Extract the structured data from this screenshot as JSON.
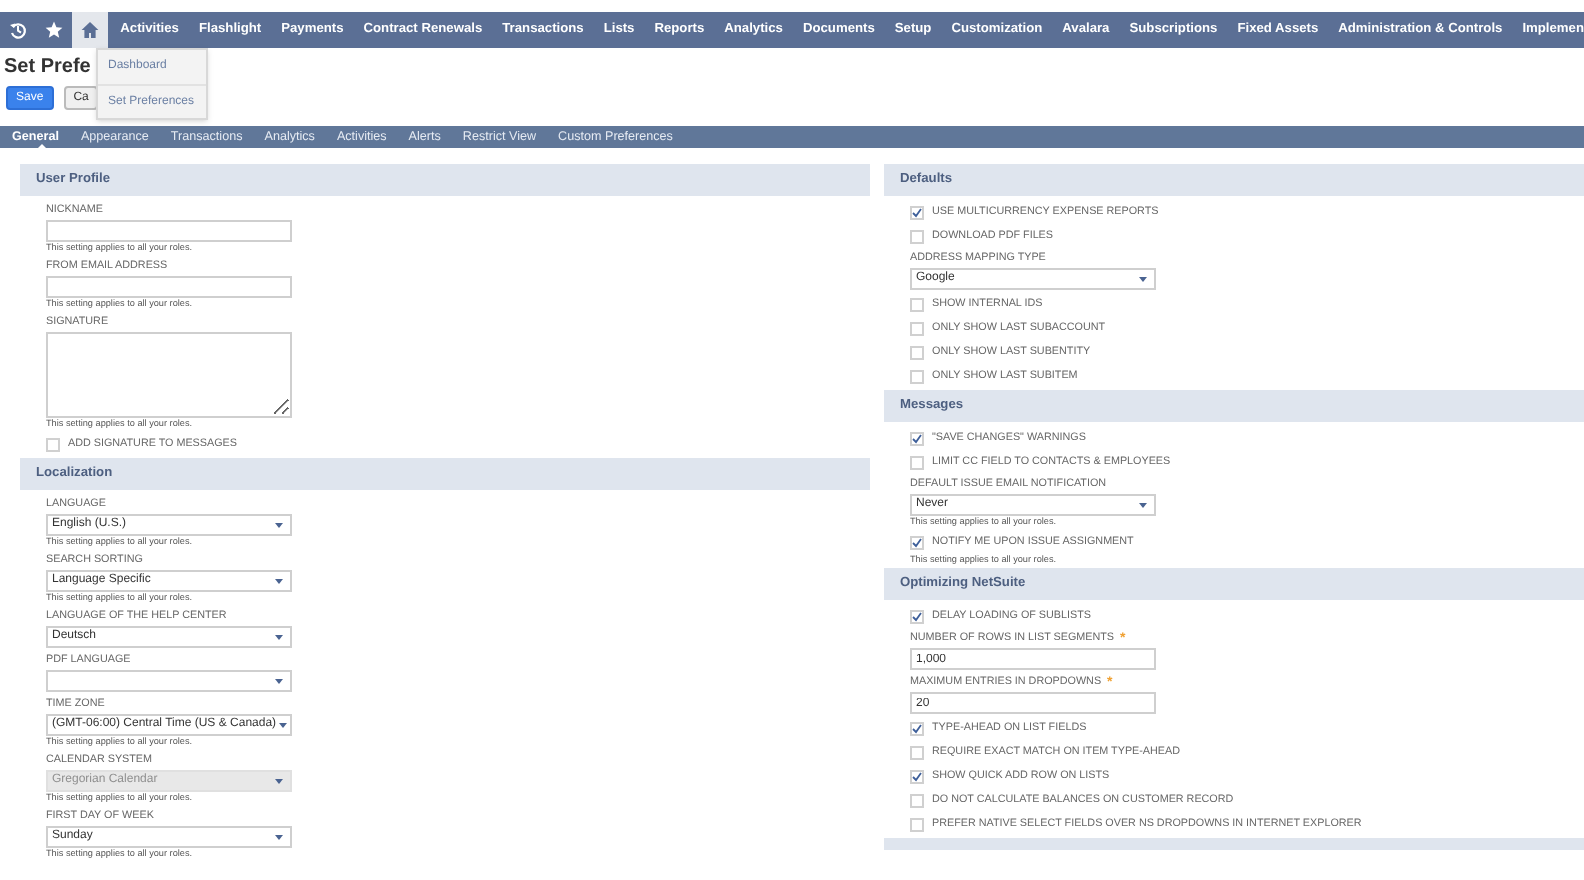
{
  "nav": {
    "icon_buttons": [
      {
        "selected": false
      },
      {
        "selected": false
      },
      {
        "selected": true
      }
    ],
    "items": [
      "Activities",
      "Flashlight",
      "Payments",
      "Contract Renewals",
      "Transactions",
      "Lists",
      "Reports",
      "Analytics",
      "Documents",
      "Setup",
      "Customization",
      "Avalara",
      "Subscriptions",
      "Fixed Assets",
      "Administration & Controls",
      "Implemen"
    ]
  },
  "menu": {
    "items": [
      "Dashboard",
      "Set Preferences"
    ]
  },
  "page": {
    "title": "Set Prefe",
    "buttons": [
      {
        "label": "Save",
        "kind": "primary"
      },
      {
        "label": "Ca",
        "kind": "secondary"
      }
    ]
  },
  "tabs": [
    {
      "label": "General",
      "selected": true
    },
    {
      "label": "Appearance",
      "selected": false
    },
    {
      "label": "Transactions",
      "selected": false
    },
    {
      "label": "Analytics",
      "selected": false
    },
    {
      "label": "Activities",
      "selected": false
    },
    {
      "label": "Alerts",
      "selected": false
    },
    {
      "label": "Restrict View",
      "selected": false
    },
    {
      "label": "Custom Preferences",
      "selected": false
    }
  ],
  "left_sections": [
    {
      "title": "User Profile",
      "items": [
        {
          "kind": "text",
          "label": "NICKNAME",
          "note": "This setting applies to all your roles."
        },
        {
          "kind": "text",
          "label": "FROM EMAIL ADDRESS",
          "note": "This setting applies to all your roles."
        },
        {
          "kind": "textarea",
          "label": "SIGNATURE",
          "note": "This setting applies to all your roles."
        },
        {
          "kind": "checkbox",
          "label": "ADD SIGNATURE TO MESSAGES",
          "checked": false
        }
      ]
    },
    {
      "title": "Localization",
      "items": [
        {
          "kind": "select",
          "label": "LANGUAGE",
          "value": "English (U.S.)",
          "disabled": false,
          "note": "This setting applies to all your roles."
        },
        {
          "kind": "select",
          "label": "SEARCH SORTING",
          "value": "Language Specific",
          "disabled": false,
          "note": "This setting applies to all your roles."
        },
        {
          "kind": "select",
          "label": "LANGUAGE OF THE HELP CENTER",
          "value": "Deutsch",
          "disabled": false
        },
        {
          "kind": "select",
          "label": "PDF LANGUAGE",
          "disabled": false
        },
        {
          "kind": "select",
          "label": "TIME ZONE",
          "value": "(GMT-06:00) Central Time (US & Canada)",
          "disabled": false,
          "note": "This setting applies to all your roles."
        },
        {
          "kind": "select",
          "label": "CALENDAR SYSTEM",
          "value": "Gregorian Calendar",
          "disabled": true,
          "note": "This setting applies to all your roles."
        },
        {
          "kind": "select",
          "label": "FIRST DAY OF WEEK",
          "value": "Sunday",
          "disabled": false,
          "note": "This setting applies to all your roles."
        }
      ]
    }
  ],
  "right_sections": [
    {
      "title": "Defaults",
      "items": [
        {
          "kind": "checkbox",
          "label": "USE MULTICURRENCY EXPENSE REPORTS",
          "checked": true
        },
        {
          "kind": "checkbox",
          "label": "DOWNLOAD PDF FILES",
          "checked": false
        },
        {
          "kind": "select",
          "label": "ADDRESS MAPPING TYPE",
          "value": "Google",
          "disabled": false
        },
        {
          "kind": "checkbox",
          "label": "SHOW INTERNAL IDS",
          "checked": false
        },
        {
          "kind": "checkbox",
          "label": "ONLY SHOW LAST SUBACCOUNT",
          "checked": false
        },
        {
          "kind": "checkbox",
          "label": "ONLY SHOW LAST SUBENTITY",
          "checked": false
        },
        {
          "kind": "checkbox",
          "label": "ONLY SHOW LAST SUBITEM",
          "checked": false
        }
      ]
    },
    {
      "title": "Messages",
      "items": [
        {
          "kind": "checkbox",
          "label": "\"SAVE CHANGES\" WARNINGS",
          "checked": true
        },
        {
          "kind": "checkbox",
          "label": "LIMIT CC FIELD TO CONTACTS & EMPLOYEES",
          "checked": false
        },
        {
          "kind": "select",
          "label": "DEFAULT ISSUE EMAIL NOTIFICATION",
          "value": "Never",
          "disabled": false,
          "note": "This setting applies to all your roles."
        },
        {
          "kind": "checkbox",
          "label": "NOTIFY ME UPON ISSUE ASSIGNMENT",
          "checked": true,
          "note": "This setting applies to all your roles."
        }
      ]
    },
    {
      "title": "Optimizing NetSuite",
      "items": [
        {
          "kind": "checkbox",
          "label": "DELAY LOADING OF SUBLISTS",
          "checked": true
        },
        {
          "kind": "text",
          "label": "NUMBER OF ROWS IN LIST SEGMENTS",
          "required": true,
          "required_mark": "*",
          "value": "1,000"
        },
        {
          "kind": "text",
          "label": "MAXIMUM ENTRIES IN DROPDOWNS",
          "required": true,
          "required_mark": "*",
          "value": "20"
        },
        {
          "kind": "checkbox",
          "label": "TYPE-AHEAD ON LIST FIELDS",
          "checked": true
        },
        {
          "kind": "checkbox",
          "label": "REQUIRE EXACT MATCH ON ITEM TYPE-AHEAD",
          "checked": false
        },
        {
          "kind": "checkbox",
          "label": "SHOW QUICK ADD ROW ON LISTS",
          "checked": true
        },
        {
          "kind": "checkbox",
          "label": "DO NOT CALCULATE BALANCES ON CUSTOMER RECORD",
          "checked": false
        },
        {
          "kind": "checkbox",
          "label": "PREFER NATIVE SELECT FIELDS OVER NS DROPDOWNS IN INTERNET EXPLORER",
          "checked": false
        }
      ]
    }
  ]
}
